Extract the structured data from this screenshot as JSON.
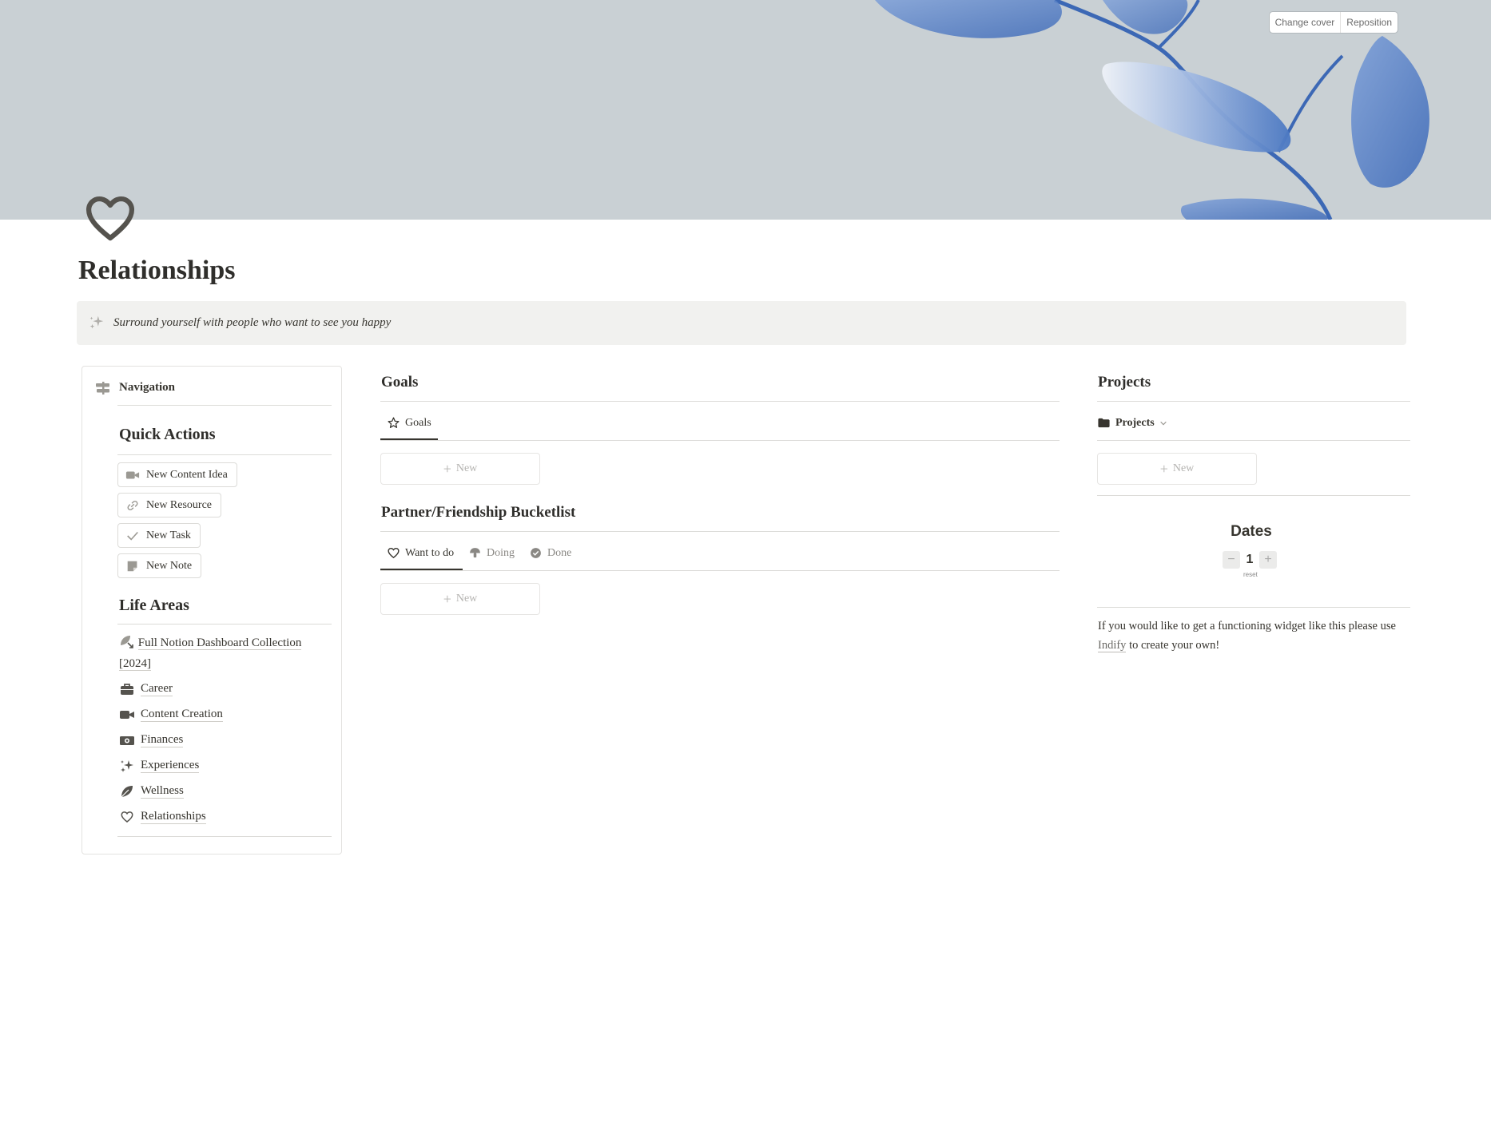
{
  "cover": {
    "change_cover_label": "Change cover",
    "reposition_label": "Reposition",
    "background_color": "#c9d0d4",
    "leaf_color": "#4a76c0"
  },
  "page": {
    "icon": "heart-outline-icon",
    "title": "Relationships",
    "callout_icon": "sparkles-icon",
    "callout_text": "Surround yourself with people who want to see you happy"
  },
  "navigation": {
    "header_label": "Navigation",
    "header_icon": "signpost-icon",
    "quick_actions_title": "Quick Actions",
    "quick_actions": [
      {
        "label": "New Content Idea",
        "icon": "video-camera-icon"
      },
      {
        "label": "New Resource",
        "icon": "link-icon"
      },
      {
        "label": "New Task",
        "icon": "checkmark-icon"
      },
      {
        "label": "New Note",
        "icon": "sticky-note-icon"
      }
    ],
    "life_areas_title": "Life Areas",
    "life_areas": [
      {
        "label": "Full Notion Dashboard Collection [2024]",
        "icon": "leaf-link-icon"
      },
      {
        "label": "Career",
        "icon": "briefcase-icon"
      },
      {
        "label": "Content Creation",
        "icon": "video-camera-icon"
      },
      {
        "label": "Finances",
        "icon": "money-icon"
      },
      {
        "label": "Experiences",
        "icon": "sparkles-icon"
      },
      {
        "label": "Wellness",
        "icon": "leaf-icon"
      },
      {
        "label": "Relationships",
        "icon": "heart-icon"
      }
    ]
  },
  "goals": {
    "title": "Goals",
    "tab_label": "Goals",
    "tab_icon": "star-icon",
    "new_label": "New"
  },
  "bucketlist": {
    "title": "Partner/Friendship Bucketlist",
    "tabs": [
      {
        "label": "Want to do",
        "icon": "heart-icon"
      },
      {
        "label": "Doing",
        "icon": "mushroom-icon"
      },
      {
        "label": "Done",
        "icon": "check-circle-icon"
      }
    ],
    "new_label": "New"
  },
  "projects": {
    "title": "Projects",
    "view_label": "Projects",
    "view_icon": "folder-icon",
    "new_label": "New"
  },
  "dates_widget": {
    "title": "Dates",
    "minus_label": "−",
    "count": "1",
    "plus_label": "+",
    "reset_label": "reset"
  },
  "widget_note": {
    "before": "If you would like to get a functioning widget like this please use ",
    "link_text": "Indify",
    "after": " to create your own!"
  }
}
